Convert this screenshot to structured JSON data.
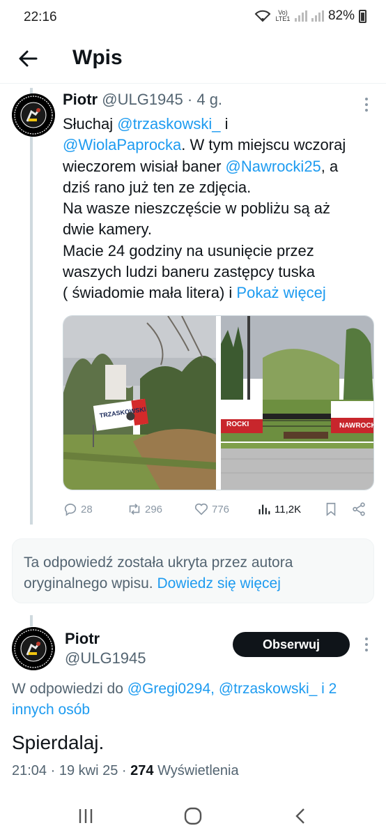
{
  "status_bar": {
    "time": "22:16",
    "network": "Vo) LTE1",
    "battery": "82%"
  },
  "header": {
    "title": "Wpis"
  },
  "tweet": {
    "author_name": "Piotr",
    "author_handle": "@ULG1945",
    "separator": "·",
    "age": "4 g.",
    "text": {
      "l1_a": "Słuchaj ",
      "l1_mention": "@trzaskowski_",
      "l1_b": " i",
      "l2_mention": "@WiolaPaprocka",
      "l2_b": ". W tym miejscu wczoraj",
      "l3_a": "wieczorem wisiał baner ",
      "l3_mention": "@Nawrocki25",
      "l3_b": ", a",
      "l4": "dziś rano już ten ze zdjęcia.",
      "l5": "Na wasze nieszczęście w pobliżu są aż",
      "l6": "dwie kamery.",
      "l7": "Macie 24 godziny na usunięcie przez",
      "l8": "waszych ludzi baneru zastępcy tuska",
      "l9": "( świadomie mała litera) i ",
      "show_more": "Pokaż więcej"
    },
    "media": {
      "photo1_banner_title": "TRZASKOWSKI",
      "photo2_banner_text": "NAWROCKI",
      "photo2_banner_text_short": "ROCKI"
    },
    "actions": {
      "replies": "28",
      "reposts": "296",
      "likes": "776",
      "views": "11,2K"
    }
  },
  "hidden_notice": {
    "text": "Ta odpowiedź została ukryta przez autora oryginalnego wpisu. ",
    "link": "Dowiedz się więcej"
  },
  "reply": {
    "author_name": "Piotr",
    "author_handle": "@ULG1945",
    "follow_label": "Obserwuj",
    "replying_to_prefix": "W odpowiedzi do ",
    "replying_to_links": "@Gregi0294, @trzaskowski_ i 2 innych osób",
    "text": "Spierdalaj.",
    "time": "21:04",
    "date": "19 kwi 25",
    "views_count": "274",
    "views_label": "Wyświetlenia"
  },
  "colors": {
    "accent": "#1d9bf0",
    "text": "#0f1419",
    "muted": "#536471"
  }
}
